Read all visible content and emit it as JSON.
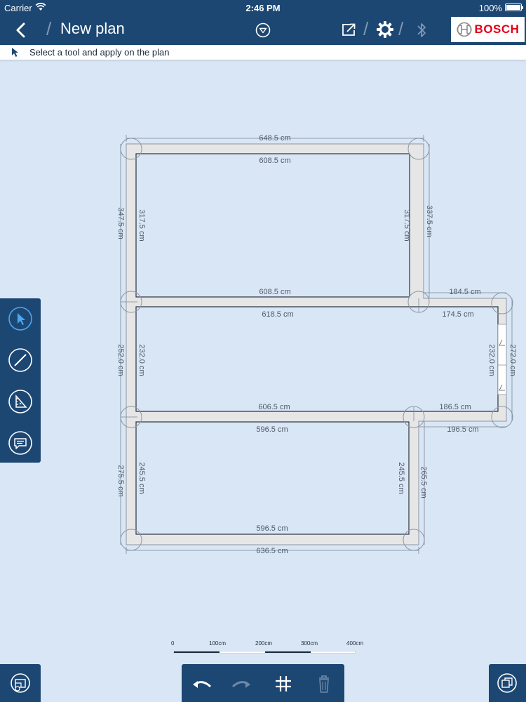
{
  "status_bar": {
    "carrier": "Carrier",
    "time": "2:46 PM",
    "battery": "100%"
  },
  "nav": {
    "title": "New plan",
    "brand": "BOSCH"
  },
  "hint": {
    "text": "Select a tool and apply on the plan"
  },
  "plan": {
    "dimensions": {
      "top_outer": "648.5 cm",
      "top_inner": "608.5 cm",
      "left_outer_1": "347.5 cm",
      "left_inner_1": "317.5 cm",
      "right_inner_1": "317.5 cm",
      "right_outer_1": "337.5 cm",
      "mid1_upper": "608.5 cm",
      "mid1_lower": "618.5 cm",
      "ext_upper": "184.5 cm",
      "ext_lower": "174.5 cm",
      "left_outer_2": "252.0 cm",
      "left_inner_2": "232.0 cm",
      "right_inner_2": "232.0 cm",
      "right_outer_2": "272.0 cm",
      "mid2_upper": "606.5 cm",
      "mid2_ext_upper": "186.5 cm",
      "mid2_lower": "596.5 cm",
      "mid2_ext_lower": "196.5 cm",
      "left_outer_3": "275.5 cm",
      "left_inner_3": "245.5 cm",
      "right_inner_3": "245.5 cm",
      "right_outer_3": "265.5 cm",
      "bottom_inner": "596.5 cm",
      "bottom_outer": "636.5 cm"
    }
  },
  "scale": {
    "labels": [
      "0",
      "100cm",
      "200cm",
      "300cm",
      "400cm"
    ]
  },
  "icons": {
    "back": "chevron-left-icon",
    "dropdown": "dropdown-circle-icon",
    "share": "share-icon",
    "settings": "gear-icon",
    "bluetooth": "bluetooth-icon",
    "select_tool": "cursor-icon",
    "wall_tool": "line-tool-icon",
    "measure_tool": "measure-tool-icon",
    "comment_tool": "comment-icon",
    "undo": "undo-icon",
    "redo": "redo-icon",
    "grid": "grid-icon",
    "delete": "trash-icon",
    "plans": "plans-overview-icon",
    "copy": "copy-icon"
  },
  "colors": {
    "toolbar": "#1d4773",
    "canvas": "#d9e6f5",
    "wall": "#e6e6e6",
    "active_tool": "#4aa8f0",
    "brand_red": "#e2001a"
  }
}
